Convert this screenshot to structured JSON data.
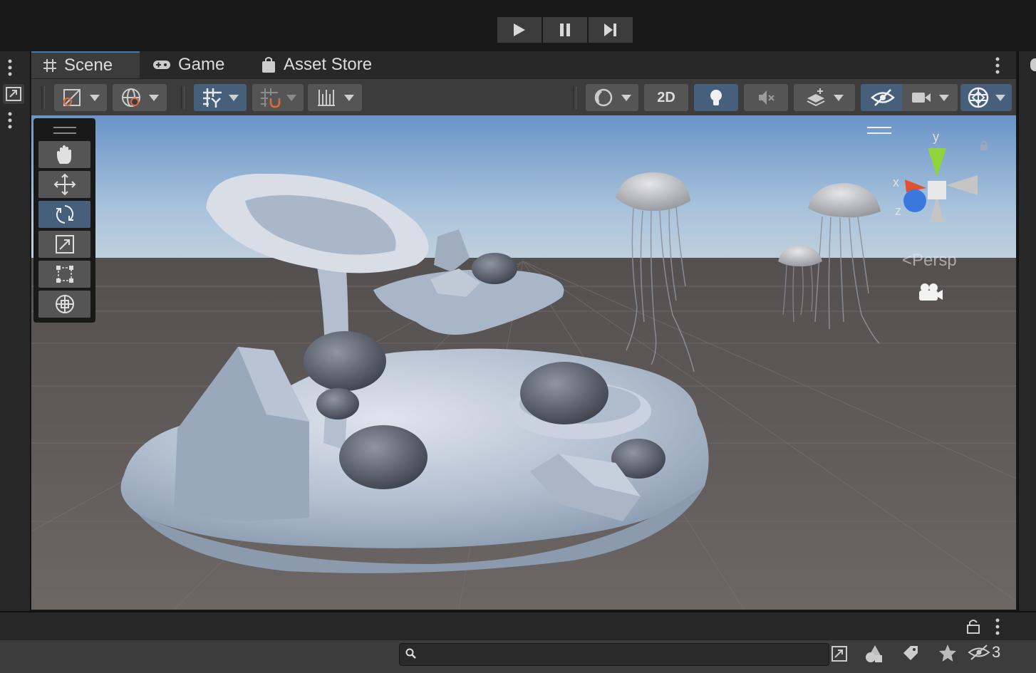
{
  "playbar": {
    "buttons": [
      {
        "name": "play",
        "icon": "play-icon"
      },
      {
        "name": "pause",
        "icon": "pause-icon"
      },
      {
        "name": "step",
        "icon": "step-icon"
      }
    ]
  },
  "tabs": [
    {
      "label": "Scene",
      "icon": "grid-hash-icon",
      "active": true
    },
    {
      "label": "Game",
      "icon": "gamepad-icon",
      "active": false
    },
    {
      "label": "Asset Store",
      "icon": "shopping-bag-icon",
      "active": false
    }
  ],
  "toolbar": {
    "toggle_2d_label": "2D"
  },
  "tools": [
    "hand-icon",
    "move-icon",
    "rotate-icon",
    "scale-icon",
    "rect-tool-icon",
    "transform-icon"
  ],
  "active_tool": "rotate-icon",
  "gizmo": {
    "axis_x": "x",
    "axis_y": "y",
    "axis_z": "z",
    "projection_label": "Persp"
  },
  "bottom": {
    "search_value": "",
    "hidden_count": "3"
  },
  "colors": {
    "accent": "#46607c",
    "panel": "#3c3c3c",
    "background": "#191919"
  }
}
